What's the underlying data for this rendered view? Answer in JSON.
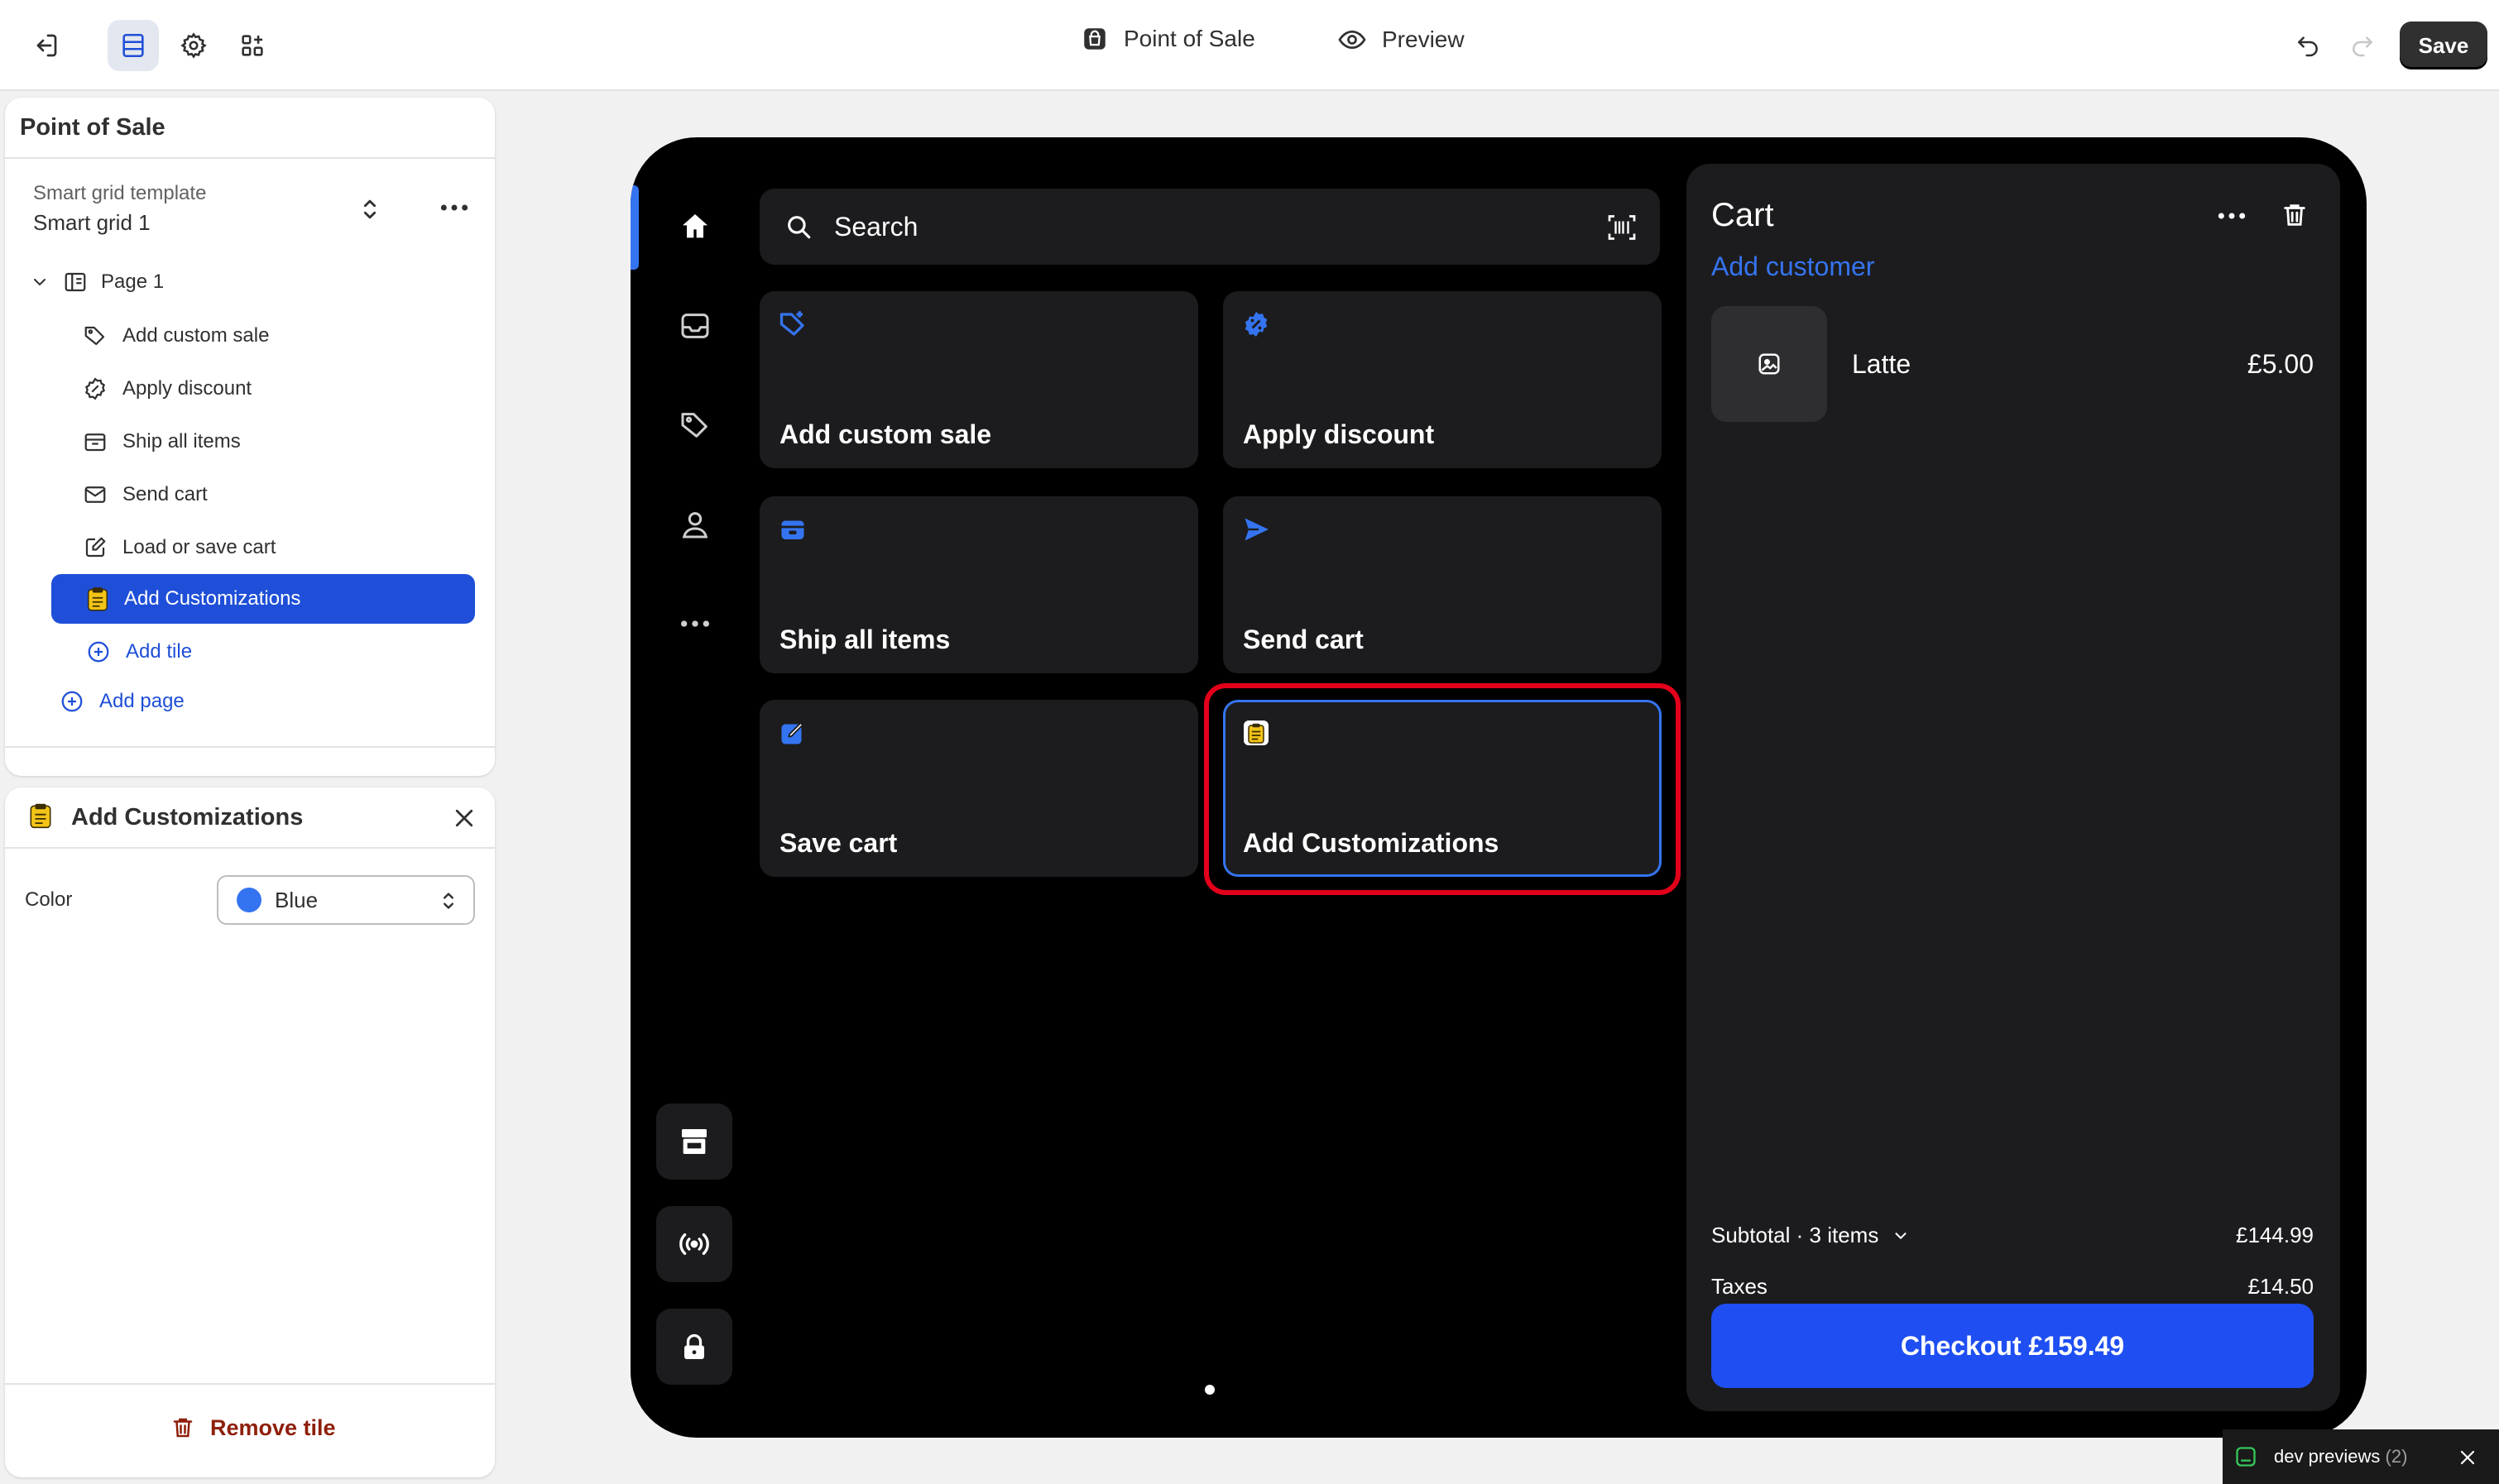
{
  "topbar": {
    "center_tabs": [
      {
        "label": "Point of Sale",
        "icon": "pos-bag-icon"
      },
      {
        "label": "Preview",
        "icon": "eye-icon"
      }
    ],
    "save_label": "Save"
  },
  "navigator": {
    "title": "Point of Sale",
    "template_label": "Smart grid template",
    "template_value": "Smart grid 1",
    "page": {
      "label": "Page 1"
    },
    "items": [
      {
        "label": "Add custom sale",
        "icon": "tag-plus-icon"
      },
      {
        "label": "Apply discount",
        "icon": "discount-icon"
      },
      {
        "label": "Ship all items",
        "icon": "ship-box-icon"
      },
      {
        "label": "Send cart",
        "icon": "envelope-icon"
      },
      {
        "label": "Load or save cart",
        "icon": "cart-edit-icon"
      },
      {
        "label": "Add Customizations",
        "icon": "clipboard-icon",
        "selected": true
      }
    ],
    "add_tile_label": "Add tile",
    "add_page_label": "Add page"
  },
  "settings": {
    "title": "Add Customizations",
    "color_label": "Color",
    "color_value": "Blue",
    "color_hex": "#3574f0",
    "remove_label": "Remove tile"
  },
  "pos": {
    "search_placeholder": "Search",
    "tiles": [
      {
        "label": "Add custom sale",
        "icon": "tag-plus-icon"
      },
      {
        "label": "Apply discount",
        "icon": "discount-badge-icon"
      },
      {
        "label": "Ship all items",
        "icon": "package-icon"
      },
      {
        "label": "Send cart",
        "icon": "paper-plane-icon"
      },
      {
        "label": "Save cart",
        "icon": "edit-square-icon"
      },
      {
        "label": "Add Customizations",
        "icon": "clipboard-icon",
        "selected": true
      }
    ],
    "cart": {
      "title": "Cart",
      "add_customer": "Add customer",
      "items": [
        {
          "name": "Latte",
          "price": "£5.00"
        }
      ],
      "subtotal_label": "Subtotal · 3 items",
      "subtotal_value": "£144.99",
      "taxes_label": "Taxes",
      "taxes_value": "£14.50",
      "checkout_label": "Checkout £159.49"
    }
  },
  "dev_previews": {
    "label": "dev previews",
    "count": "(2)"
  },
  "colors": {
    "accent": "#1f4fd8",
    "pos_blue": "#3574f0",
    "highlight": "#e3001b",
    "danger": "#8e1f0b"
  }
}
